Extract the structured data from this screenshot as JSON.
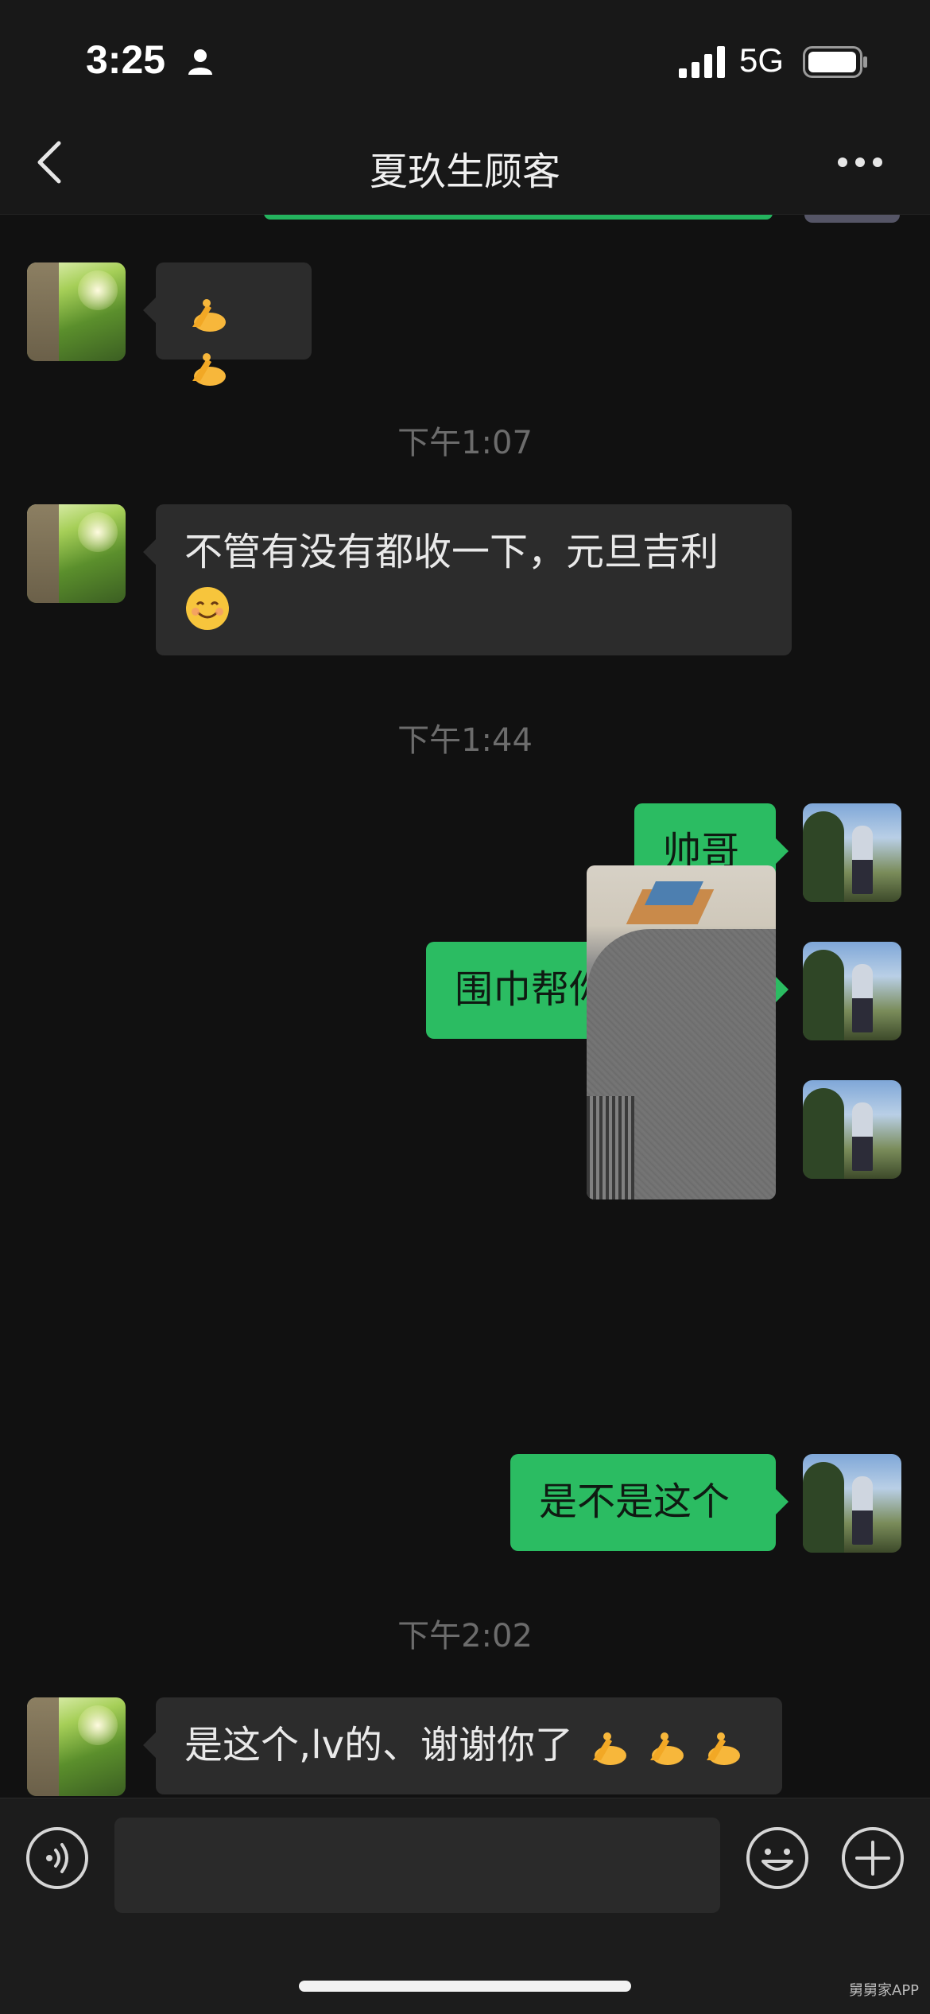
{
  "status_bar": {
    "time": "3:25",
    "network": "5G"
  },
  "nav": {
    "title": "夏玖生顾客"
  },
  "messages": {
    "m1_text": "",
    "ts1": "下午1:07",
    "m2_text": "不管有没有都收一下，元旦吉利",
    "ts2": "下午1:44",
    "m3_text": "帅哥",
    "m4_text": "围巾帮你找到了",
    "m6_text": "是不是这个",
    "ts3": "下午2:02",
    "m7_text": "是这个,lv的、谢谢你了"
  },
  "input": {
    "value": "",
    "placeholder": ""
  },
  "watermark": "舅舅家APP",
  "colors": {
    "bubble_out": "#2bbc62",
    "bubble_in": "#2c2c2c",
    "background": "#111111"
  },
  "icons": [
    "person-icon",
    "signal-icon",
    "battery-icon",
    "back-icon",
    "more-icon",
    "voice-icon",
    "emoji-icon",
    "plus-icon",
    "ok-hand-emoji",
    "smiling-face-emoji"
  ]
}
